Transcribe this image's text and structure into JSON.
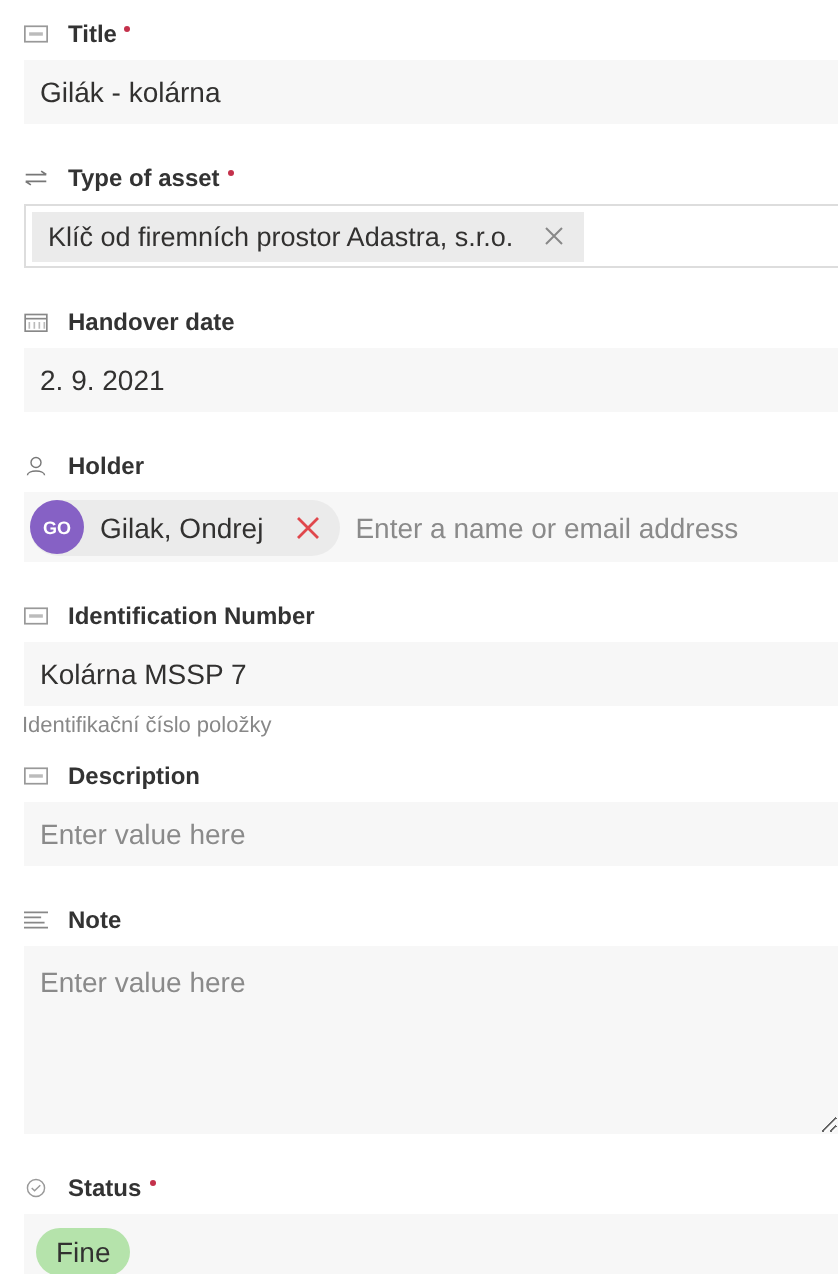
{
  "fields": [
    {
      "kind": "text",
      "label": "Title",
      "required": true,
      "value": "Gilák - kolárna"
    },
    {
      "kind": "choice",
      "label": "Type of asset",
      "required": true,
      "tags": [
        "Klíč od firemních prostor Adastra, s.r.o."
      ]
    },
    {
      "kind": "date",
      "label": "Handover date",
      "required": false,
      "value": "2. 9. 2021"
    },
    {
      "kind": "person",
      "label": "Holder",
      "required": false,
      "people": [
        {
          "initials": "GO",
          "name": "Gilak, Ondrej",
          "color": "#8661c5"
        }
      ],
      "placeholder": "Enter a name or email address"
    },
    {
      "kind": "text",
      "label": "Identification Number",
      "required": false,
      "value": "Kolárna MSSP 7",
      "hint": "Identifikační číslo položky"
    },
    {
      "kind": "text",
      "label": "Description",
      "required": false,
      "placeholder": "Enter value here"
    },
    {
      "kind": "note",
      "label": "Note",
      "required": false,
      "placeholder": "Enter value here"
    },
    {
      "kind": "status",
      "label": "Status",
      "required": true,
      "value": "Fine"
    }
  ]
}
